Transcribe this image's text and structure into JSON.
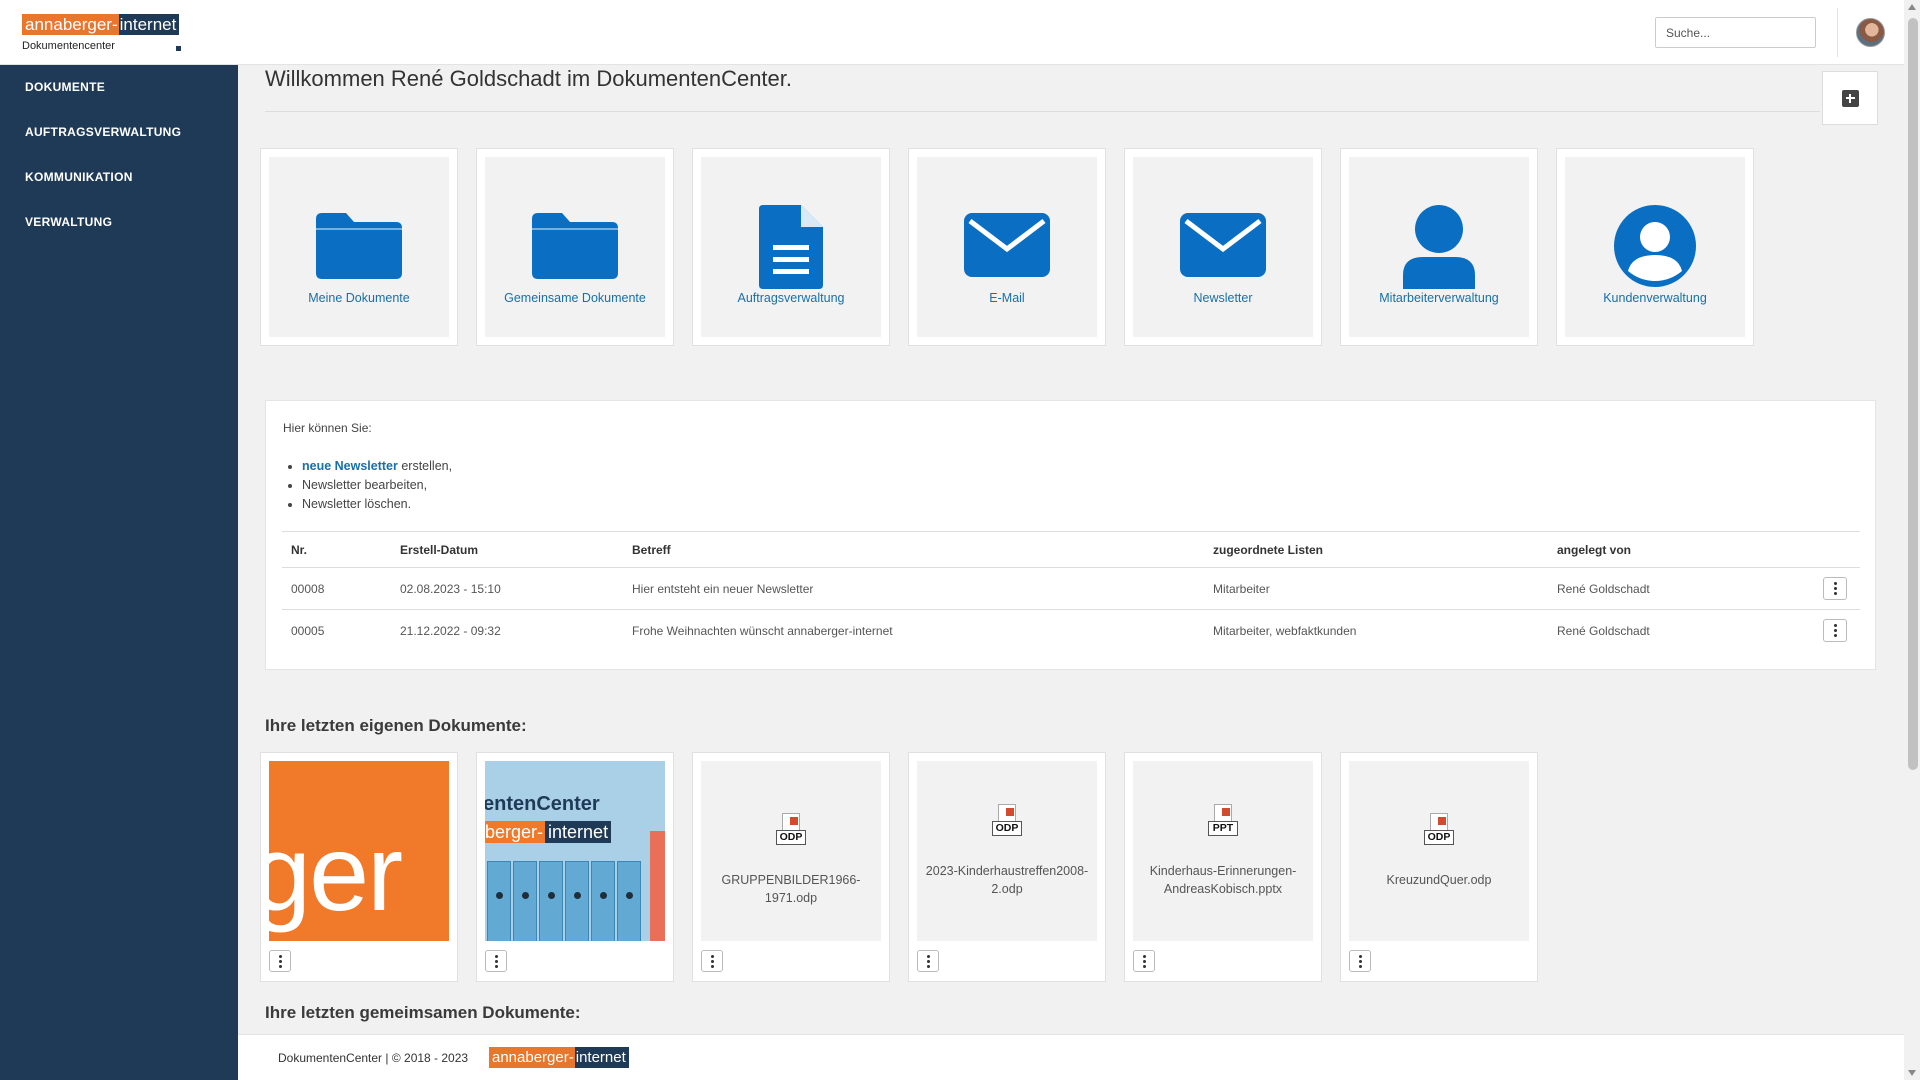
{
  "header": {
    "logo_part1": "annaberger-",
    "logo_part2": "internet",
    "logo_subtitle": "Dokumentencenter",
    "search_placeholder": "Suche..."
  },
  "sidebar": {
    "items": [
      {
        "label": "DOKUMENTE"
      },
      {
        "label": "AUFTRAGSVERWALTUNG"
      },
      {
        "label": "KOMMUNIKATION"
      },
      {
        "label": "VERWALTUNG"
      }
    ]
  },
  "main": {
    "title": "Willkommen René Goldschadt im DokumentenCenter.",
    "tiles": [
      {
        "label": "Meine Dokumente",
        "icon": "folder-icon"
      },
      {
        "label": "Gemeinsame Dokumente",
        "icon": "folder-icon"
      },
      {
        "label": "Auftragsverwaltung",
        "icon": "document-icon"
      },
      {
        "label": "E-Mail",
        "icon": "envelope-icon"
      },
      {
        "label": "Newsletter",
        "icon": "envelope-icon"
      },
      {
        "label": "Mitarbeiterverwaltung",
        "icon": "user-icon"
      },
      {
        "label": "Kundenverwaltung",
        "icon": "user-circle-icon"
      }
    ]
  },
  "newsletter": {
    "intro": "Hier können Sie:",
    "bullet1_link": "neue Newsletter",
    "bullet1_rest": " erstellen,",
    "bullet2": "Newsletter bearbeiten,",
    "bullet3": "Newsletter löschen.",
    "columns": [
      "Nr.",
      "Erstell-Datum",
      "Betreff",
      "zugeordnete Listen",
      "angelegt von"
    ],
    "rows": [
      {
        "nr": "00008",
        "datum": "02.08.2023 - 15:10",
        "betreff": "Hier entsteht ein neuer Newsletter",
        "listen": "Mitarbeiter",
        "von": "René Goldschadt"
      },
      {
        "nr": "00005",
        "datum": "21.12.2022 - 09:32",
        "betreff": "Frohe Weihnachten wünscht annaberger-internet",
        "listen": "Mitarbeiter, webfaktkunden",
        "von": "René Goldschadt"
      }
    ]
  },
  "own_docs": {
    "heading": "Ihre letzten eigenen Dokumente:",
    "thumb1_text": "ger",
    "thumb2_line1": "entenCenter",
    "thumb2_orange": "berger-",
    "thumb2_navy": "internet",
    "items": [
      {
        "name": "",
        "type": "image"
      },
      {
        "name": "",
        "type": "image"
      },
      {
        "name": "GRUPPENBILDER1966-1971.odp",
        "type": "ODP"
      },
      {
        "name": "2023-Kinderhaustreffen2008-2.odp",
        "type": "ODP"
      },
      {
        "name": "Kinderhaus-Erinnerungen-AndreasKobisch.pptx",
        "type": "PPT"
      },
      {
        "name": "KreuzundQuer.odp",
        "type": "ODP"
      }
    ]
  },
  "shared_docs": {
    "heading": "Ihre letzten gemeimsamen Dokumente:"
  },
  "footer": {
    "text": "DokumentenCenter  |  © 2018 - 2023",
    "logo_part1": "annaberger-",
    "logo_part2": "internet"
  },
  "colors": {
    "sidebar": "#1f3a56",
    "accent_blue": "#0a6fc2",
    "brand_orange": "#e8772e"
  }
}
